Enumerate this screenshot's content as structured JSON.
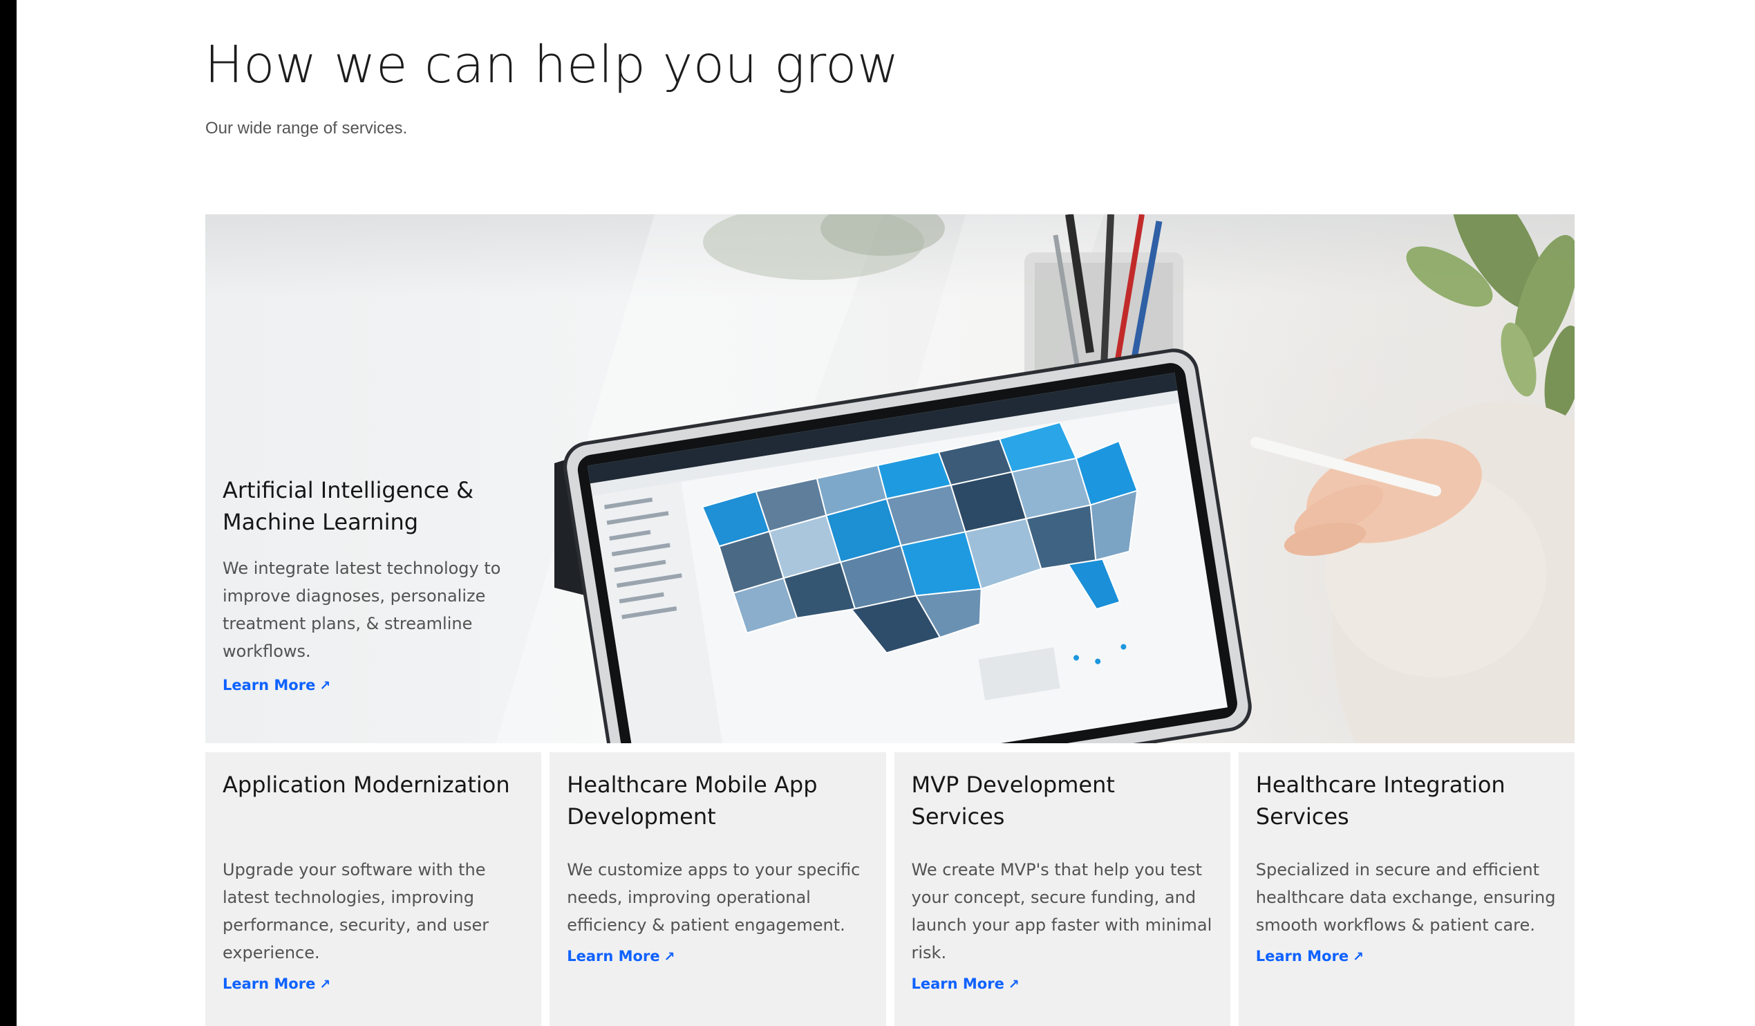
{
  "section": {
    "title": "How we can help you grow",
    "subtitle": "Our wide range of services."
  },
  "featured": {
    "title": "Artificial Intelligence & Machine Learning",
    "description": "We integrate latest technology to improve diagnoses, personalize treatment plans, & streamline workflows.",
    "link_label": "Learn More",
    "link_icon": "arrow-up-right-icon"
  },
  "services": [
    {
      "title": "Application Modernization",
      "description": "Upgrade your software with the latest technologies, improving performance, security, and user experience.",
      "link_label": "Learn More"
    },
    {
      "title": "Healthcare Mobile App Development",
      "description": "We customize apps to your specific needs, improving operational efficiency & patient engagement.",
      "link_label": "Learn More"
    },
    {
      "title": "MVP Development Services",
      "description": "We create MVP's that help you test your concept, secure funding, and launch your app faster with minimal risk.",
      "link_label": "Learn More"
    },
    {
      "title": "Healthcare Integration Services",
      "description": "Specialized in secure and efficient healthcare data exchange, ensuring smooth workflows & patient care.",
      "link_label": "Learn More"
    }
  ],
  "colors": {
    "link": "#0f62fe",
    "card_bg": "#f0f0f0",
    "heading": "#1d1d1d"
  }
}
